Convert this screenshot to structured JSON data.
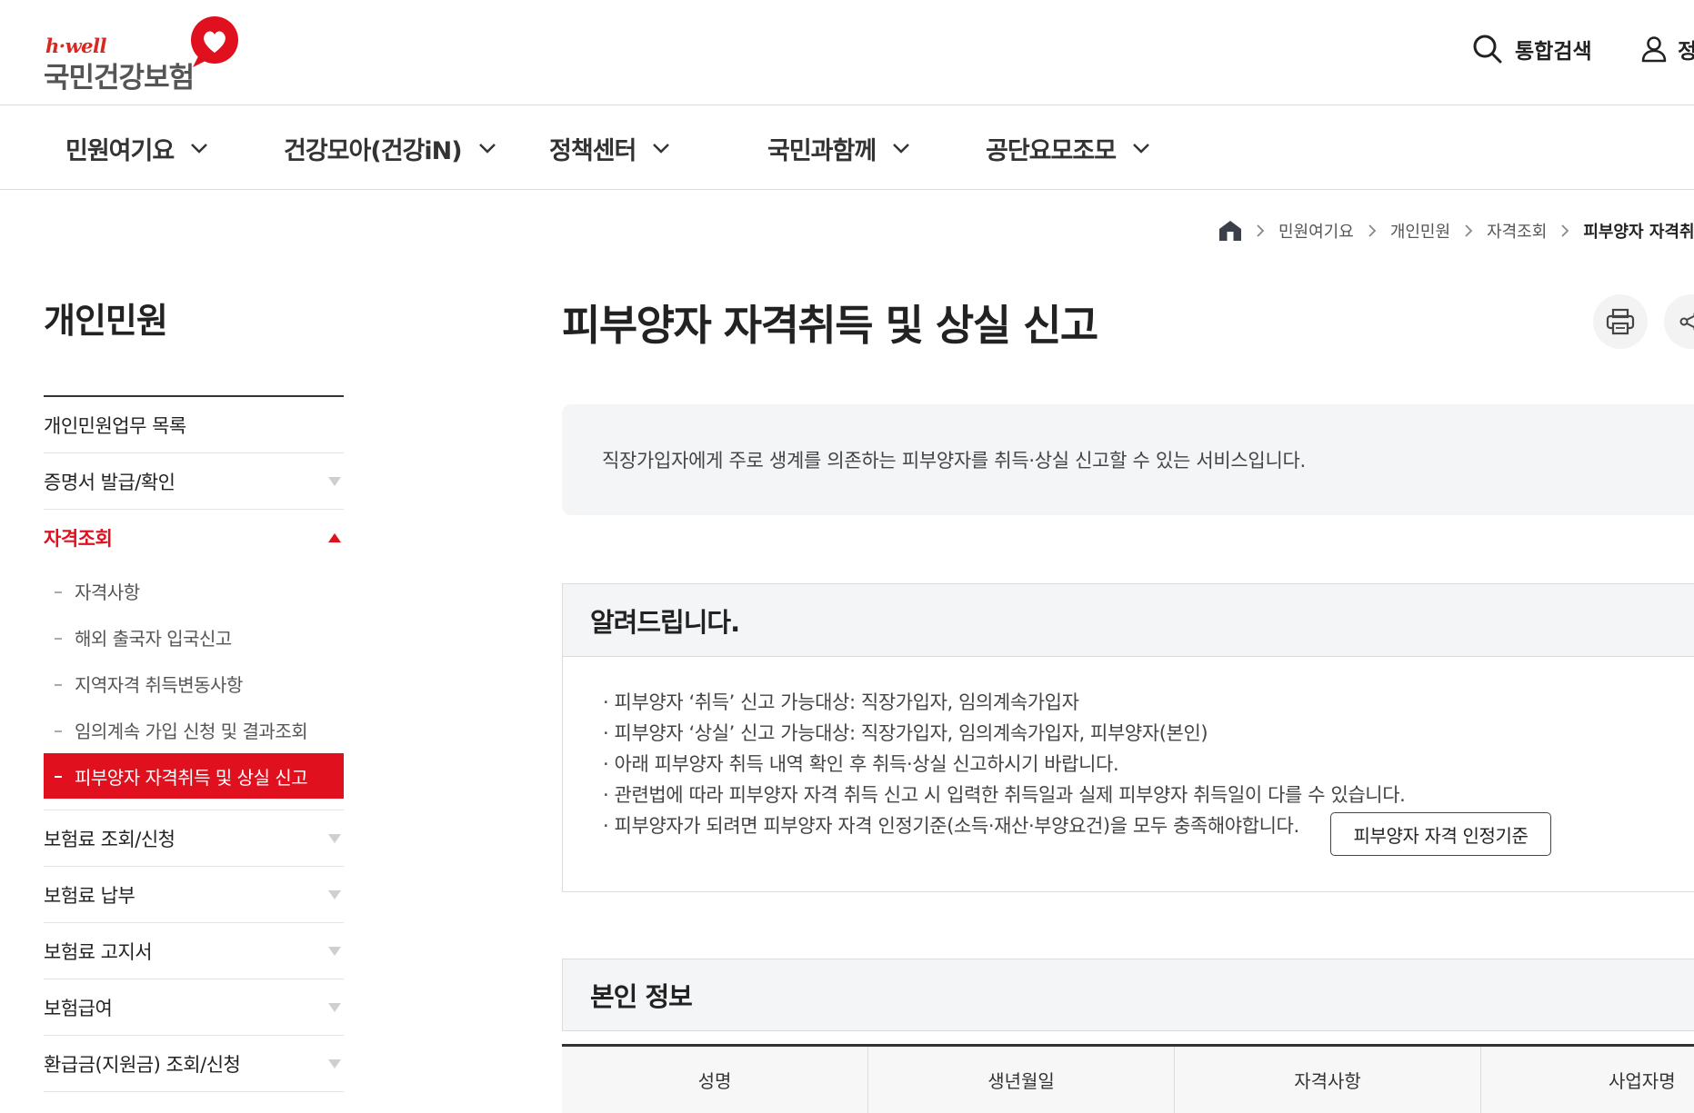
{
  "colors": {
    "accent": "#e0101f",
    "text": "#222222",
    "panel": "#f4f5f7"
  },
  "header": {
    "logo_text_en": "h·well",
    "logo_text_ko": "국민건강보험",
    "search_label": "통합검색",
    "user_label": "정"
  },
  "gnb": [
    {
      "label": "민원여기요"
    },
    {
      "label": "건강모아(건강iN)"
    },
    {
      "label": "정책센터"
    },
    {
      "label": "국민과함께"
    },
    {
      "label": "공단요모조모"
    }
  ],
  "breadcrumb": [
    "민원여기요",
    "개인민원",
    "자격조회",
    "피부양자 자격취득"
  ],
  "lnb": {
    "title": "개인민원",
    "items": [
      {
        "label": "개인민원업무 목록"
      },
      {
        "label": "증명서 발급/확인"
      },
      {
        "label": "자격조회"
      },
      {
        "label": "보험료 조회/신청"
      },
      {
        "label": "보험료 납부"
      },
      {
        "label": "보험료 고지서"
      },
      {
        "label": "보험급여"
      },
      {
        "label": "환급금(지원금) 조회/신청"
      }
    ],
    "sub_items": [
      {
        "label": "자격사항"
      },
      {
        "label": "해외 출국자 입국신고"
      },
      {
        "label": "지역자격 취득변동사항"
      },
      {
        "label": "임의계속 가입 신청 및 결과조회"
      },
      {
        "label": "피부양자 자격취득 및 상실 신고"
      }
    ]
  },
  "main": {
    "title": "피부양자 자격취득 및 상실 신고",
    "description": "직장가입자에게 주로 생계를 의존하는 피부양자를 취득·상실 신고할 수 있는 서비스입니다.",
    "notice_title": "알려드립니다.",
    "notice_lines": [
      "· 피부양자 ‘취득’ 신고 가능대상: 직장가입자, 임의계속가입자",
      "· 피부양자 ‘상실’ 신고 가능대상: 직장가입자, 임의계속가입자, 피부양자(본인)",
      "· 아래 피부양자 취득 내역 확인 후 취득·상실 신고하시기 바랍니다.",
      "· 관련법에 따라 피부양자 자격 취득 신고 시 입력한 취득일과 실제 피부양자 취득일이 다를 수 있습니다.",
      "· 피부양자가 되려면 피부양자 자격 인정기준(소득·재산·부양요건)을 모두 충족해야합니다."
    ],
    "criteria_button": "피부양자 자격 인정기준",
    "self_info_title": "본인 정보",
    "self_table_headers": [
      "성명",
      "생년월일",
      "자격사항",
      "사업자명"
    ]
  }
}
